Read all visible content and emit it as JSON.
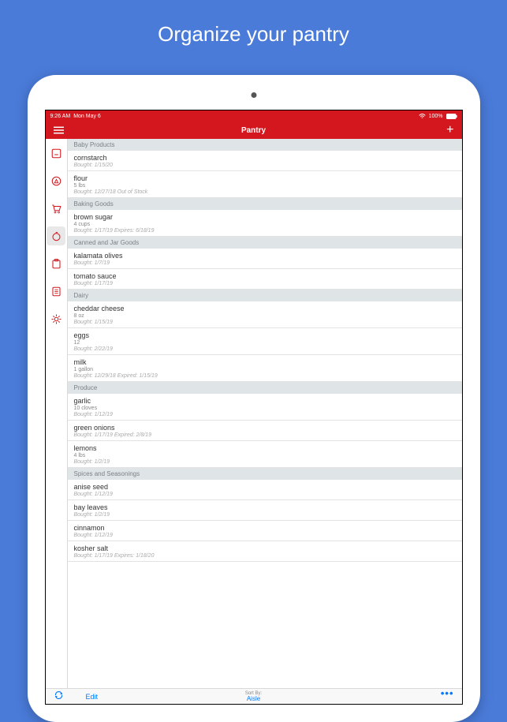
{
  "headline": "Organize your pantry",
  "status": {
    "time": "9:26 AM",
    "date": "Mon May 6",
    "battery": "100%"
  },
  "header": {
    "title": "Pantry"
  },
  "sections": [
    {
      "title": "Baby Products",
      "items": [
        {
          "name": "cornstarch",
          "qty": "",
          "meta": "Bought: 1/15/20"
        },
        {
          "name": "flour",
          "qty": "5 lbs",
          "meta": "Bought: 12/27/18  Out of Stock"
        }
      ]
    },
    {
      "title": "Baking Goods",
      "items": [
        {
          "name": "brown sugar",
          "qty": "4 cups",
          "meta": "Bought: 1/17/19  Expires: 6/18/19"
        }
      ]
    },
    {
      "title": "Canned and Jar Goods",
      "items": [
        {
          "name": "kalamata olives",
          "qty": "",
          "meta": "Bought: 1/7/19"
        },
        {
          "name": "tomato sauce",
          "qty": "",
          "meta": "Bought: 1/17/19"
        }
      ]
    },
    {
      "title": "Dairy",
      "items": [
        {
          "name": "cheddar cheese",
          "qty": "8 oz",
          "meta": "Bought: 1/15/19"
        },
        {
          "name": "eggs",
          "qty": "12",
          "meta": "Bought: 2/22/19"
        },
        {
          "name": "milk",
          "qty": "1 gallon",
          "meta": "Bought: 12/29/18  Expired: 1/15/19"
        }
      ]
    },
    {
      "title": "Produce",
      "items": [
        {
          "name": "garlic",
          "qty": "10 cloves",
          "meta": "Bought: 1/12/19"
        },
        {
          "name": "green onions",
          "qty": "",
          "meta": "Bought: 1/17/19  Expired: 2/8/19"
        },
        {
          "name": "lemons",
          "qty": "4 lbs",
          "meta": "Bought: 1/2/19"
        }
      ]
    },
    {
      "title": "Spices and Seasonings",
      "items": [
        {
          "name": "anise seed",
          "qty": "",
          "meta": "Bought: 1/12/19"
        },
        {
          "name": "bay leaves",
          "qty": "",
          "meta": "Bought: 1/2/19"
        },
        {
          "name": "cinnamon",
          "qty": "",
          "meta": "Bought: 1/12/19"
        },
        {
          "name": "kosher salt",
          "qty": "",
          "meta": "Bought: 1/17/19  Expires: 1/18/20"
        }
      ]
    }
  ],
  "bottom": {
    "edit": "Edit",
    "sort_label": "Sort By:",
    "sort_value": "Aisle"
  }
}
